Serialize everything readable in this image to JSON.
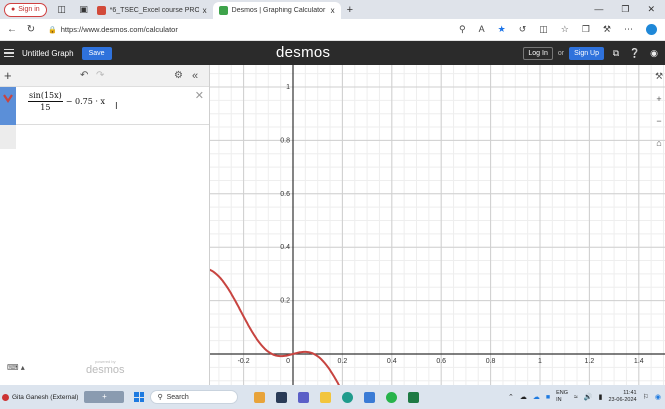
{
  "browser": {
    "signin_label": "Sign in",
    "tabs": [
      {
        "title": "*6_TSEC_Excel course PROJECT (",
        "active": false,
        "favicon_color": "#d24a3a"
      },
      {
        "title": "Desmos | Graphing Calculator",
        "active": true,
        "favicon_color": "#3ea34b"
      }
    ],
    "close_glyph": "x",
    "new_tab_glyph": "+",
    "url": "https://www.desmos.com/calculator"
  },
  "header": {
    "graph_title": "Untitled Graph",
    "save_label": "Save",
    "logo": "desmos",
    "login_label": "Log In",
    "or_label": "or",
    "signup_label": "Sign Up"
  },
  "expressions": [
    {
      "numerator": "sin(15x)",
      "denominator": "15",
      "rest": "− 0.75 · x",
      "color": "#c74440"
    }
  ],
  "panel": {
    "powered_by": "powered by",
    "powered_logo": "desmos"
  },
  "graph": {
    "x_ticks": [
      "-0.2",
      "0.2",
      "0.4",
      "0.6",
      "0.8",
      "1",
      "1.2",
      "1.4"
    ],
    "y_ticks": [
      "0.2",
      "0.4",
      "0.6",
      "0.8",
      "1"
    ],
    "origin_label": "0",
    "grid": true,
    "curve_color": "#c74440"
  },
  "taskbar": {
    "user": "Gita Ganesh (External)",
    "search_placeholder": "Search",
    "lang_top": "ENG",
    "lang_bottom": "IN",
    "time": "11:41",
    "date": "23-06-2024"
  },
  "colors": {
    "desmos_header": "#2b2b2b",
    "accent_blue": "#2f72dc",
    "tab_strip": "#dfe3ea",
    "taskbar": "#dce4ee"
  }
}
